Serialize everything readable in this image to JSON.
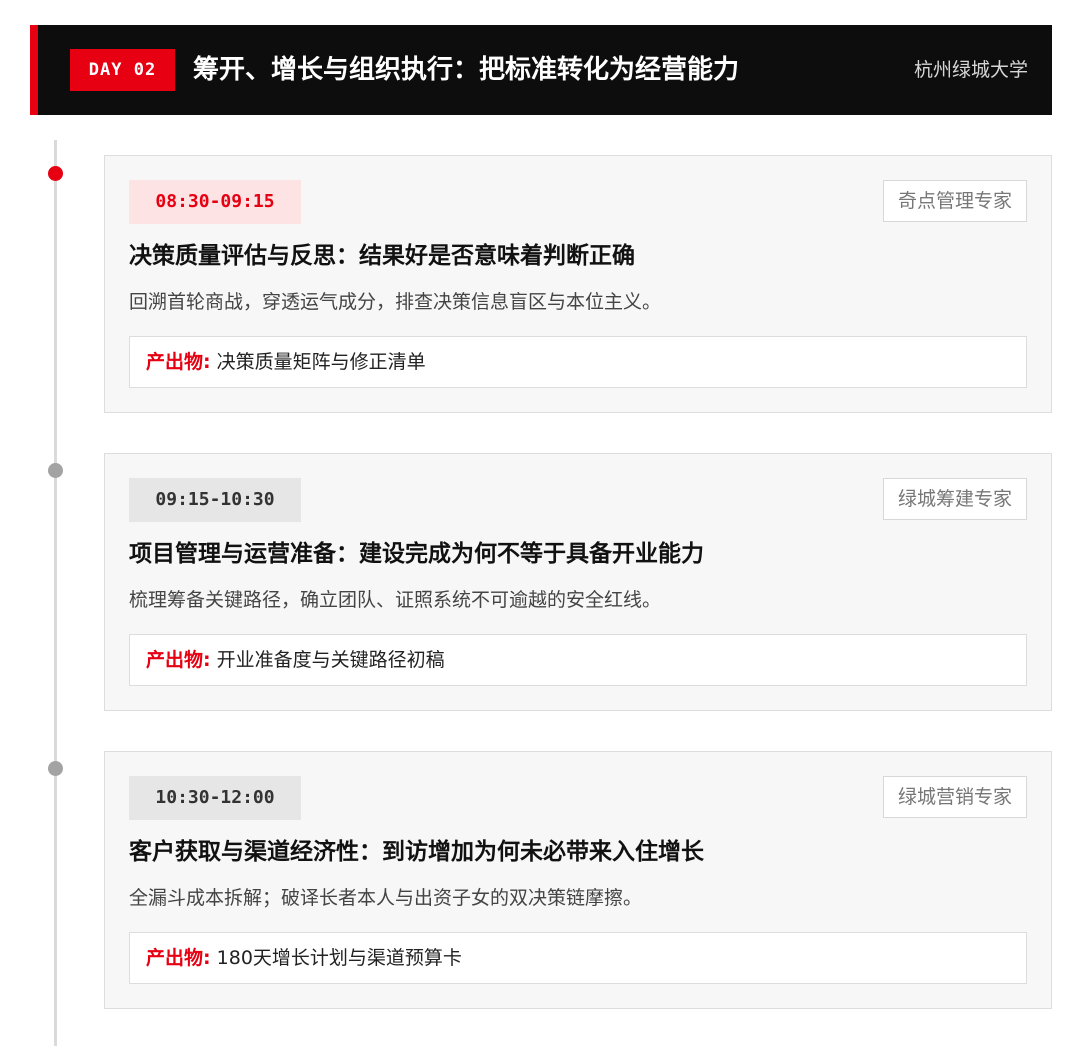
{
  "header": {
    "day_badge": "DAY 02",
    "title": "筹开、增长与组织执行：把标准转化为经营能力",
    "org": "杭州绿城大学"
  },
  "colors": {
    "accent": "#e60012",
    "header_bg": "#0d0d0d",
    "card_bg": "#f7f7f7"
  },
  "sessions": [
    {
      "time": "08:30-09:15",
      "speaker": "奇点管理专家",
      "title": "决策质量评估与反思：结果好是否意味着判断正确",
      "desc": "回溯首轮商战，穿透运气成分，排查决策信息盲区与本位主义。",
      "output_label": "产出物:",
      "output_value": "决策质量矩阵与修正清单",
      "active": true
    },
    {
      "time": "09:15-10:30",
      "speaker": "绿城筹建专家",
      "title": "项目管理与运营准备：建设完成为何不等于具备开业能力",
      "desc": "梳理筹备关键路径，确立团队、证照系统不可逾越的安全红线。",
      "output_label": "产出物:",
      "output_value": "开业准备度与关键路径初稿",
      "active": false
    },
    {
      "time": "10:30-12:00",
      "speaker": "绿城营销专家",
      "title": "客户获取与渠道经济性：到访增加为何未必带来入住增长",
      "desc": "全漏斗成本拆解；破译长者本人与出资子女的双决策链摩擦。",
      "output_label": "产出物:",
      "output_value": "180天增长计划与渠道预算卡",
      "active": false
    }
  ]
}
